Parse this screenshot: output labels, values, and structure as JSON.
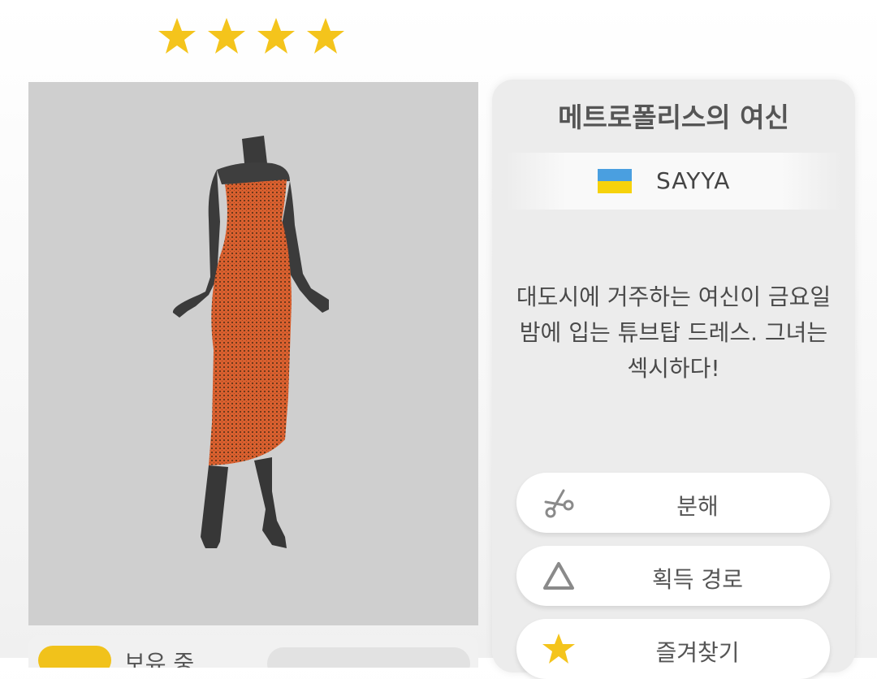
{
  "rating": {
    "stars": 4
  },
  "item": {
    "title": "메트로폴리스의 여신",
    "designer": "SAYYA",
    "designer_flag": "ukraine-flag",
    "description": "대도시에 거주하는 여신이 금요일\n밤에 입는 튜브탑 드레스. 그녀는\n섹시하다!"
  },
  "owned": {
    "label": "보유 중"
  },
  "actions": {
    "disassemble_label": "분해",
    "source_label": "획득 경로",
    "favorite_label": "즐겨찾기"
  },
  "icons": {
    "disassemble": "scissors-icon",
    "source": "triangle-icon",
    "favorite": "star-icon"
  },
  "colors": {
    "star": "#f4c41c",
    "preview_bg": "#cfcfcf",
    "dress": "#d9602f",
    "flag_blue": "#4a9fe0",
    "flag_yellow": "#f6d20c"
  }
}
